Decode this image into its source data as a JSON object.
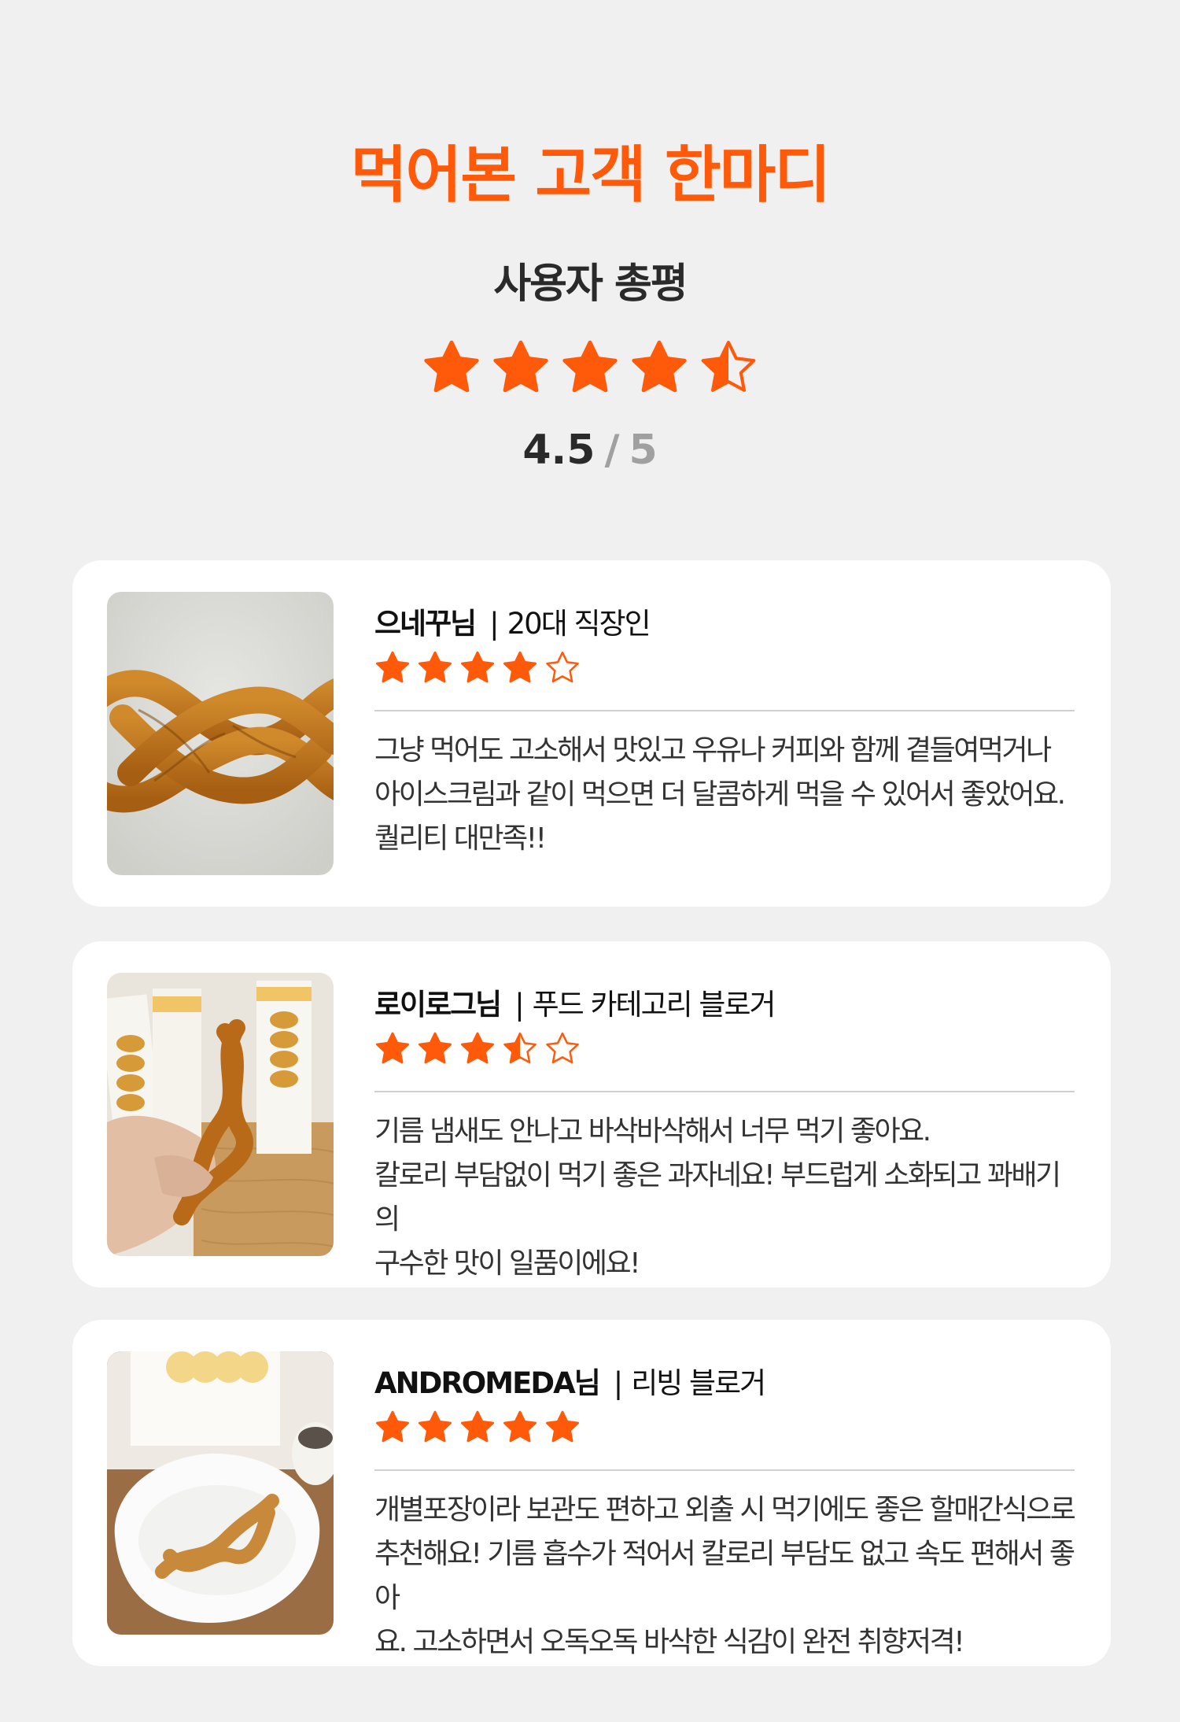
{
  "header": {
    "title": "먹어본 고객 한마디",
    "subtitle": "사용자 총평",
    "rating": 4.5,
    "score": "4.5",
    "score_sep": "/",
    "score_max": "5"
  },
  "colors": {
    "accent": "#ff5a0a",
    "background": "#f0f0f0",
    "card": "#ffffff",
    "muted": "#a0a0a0"
  },
  "reviews": [
    {
      "name": "으네꾸님",
      "separator": "|",
      "role": "20대 직장인",
      "rating": 4,
      "lines": [
        "그냥 먹어도 고소해서 맛있고 우유나 커피와 함께 곁들여먹거나",
        "아이스크림과 같이 먹으면 더 달콤하게 먹을 수 있어서 좋았어요.",
        "퀄리티 대만족!!"
      ],
      "photo": "twisted-snack-photo"
    },
    {
      "name": "로이로그님",
      "separator": "|",
      "role": "푸드 카테고리 블로거",
      "rating": 3.5,
      "lines": [
        "기름 냄새도 안나고 바삭바삭해서 너무 먹기 좋아요.",
        "칼로리 부담없이 먹기 좋은 과자네요! 부드럽게 소화되고 꽈배기의",
        "구수한 맛이 일품이에요!"
      ],
      "photo": "hand-holding-snack-photo"
    },
    {
      "name": "ANDROMEDA님",
      "separator": "|",
      "role": "리빙 블로거",
      "rating": 5,
      "lines": [
        "개별포장이라 보관도 편하고 외출 시 먹기에도 좋은 할매간식으로",
        "추천해요! 기름 흡수가 적어서 칼로리 부담도 없고 속도 편해서 좋아",
        "요. 고소하면서 오독오독 바삭한 식감이 완전 취향저격!"
      ],
      "photo": "snack-on-plate-photo"
    }
  ]
}
